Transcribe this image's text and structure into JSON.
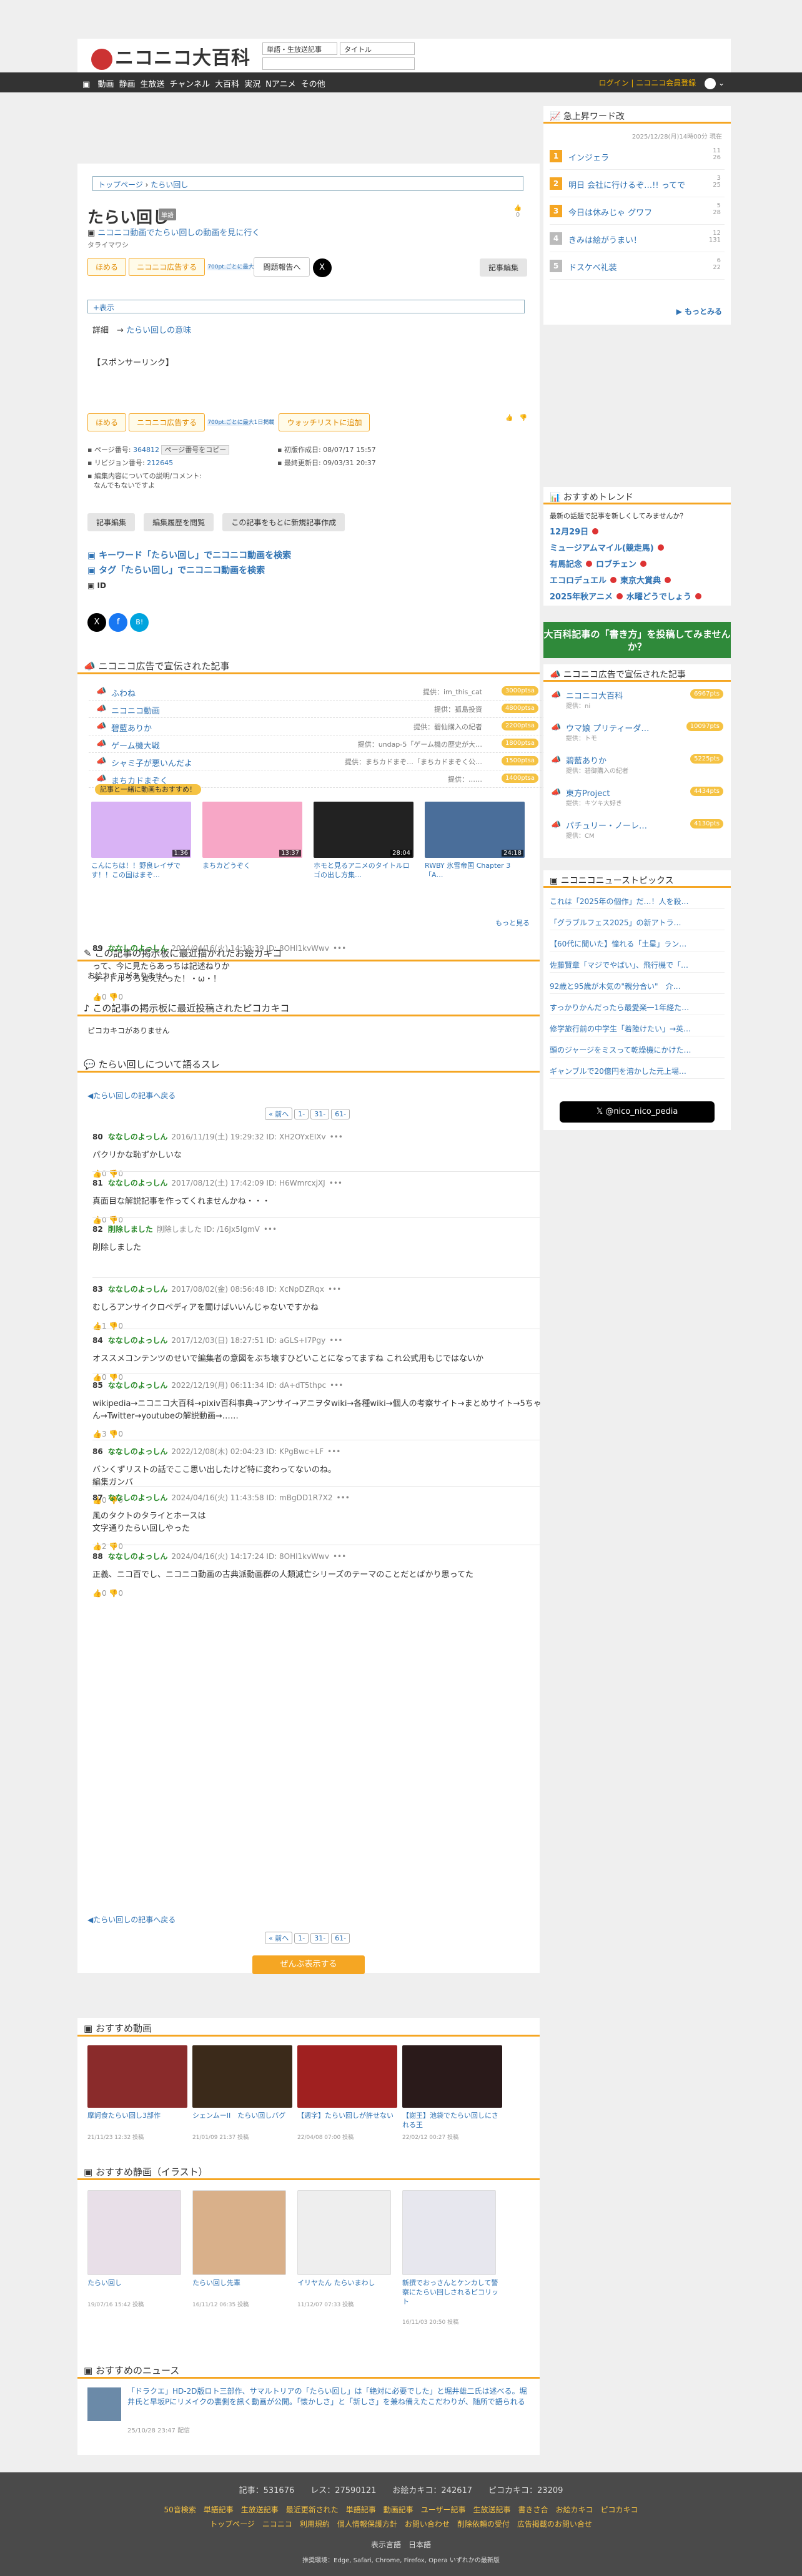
{
  "header": {
    "logo": "ニコニコ大百科",
    "select_scope": "単語・生放送記事",
    "select_field": "タイトル",
    "nav": [
      "動画",
      "静画",
      "生放送",
      "チャンネル",
      "大百科",
      "実況",
      "Nアニメ",
      "その他"
    ],
    "login": "ログイン",
    "premium": "ニコニコ会員登録"
  },
  "article": {
    "breadcrumb_top": "トップページ",
    "breadcrumb_current": "たらい回し",
    "title": "たらい回し",
    "title_tag": "単語",
    "reading": "タライマワシ",
    "video_link": "ニコニコ動画でたらい回しの動画を見に行く",
    "btn_like": "ほめる",
    "btn_ad": "ニコニコ広告する",
    "btn_ad_note": "700pt.ごとに最大1日掲載",
    "btn_report": "問題報告へ",
    "btn_edit": "記事編集",
    "likes": "0",
    "show_link": "+表示",
    "detail_label": "詳細",
    "detail_arrow": "→",
    "detail_link": "たらい回しの意味",
    "sponsor": "【スポンサーリンク】",
    "watch": "ウォッチリストに追加",
    "page_no_label": "ページ番号:",
    "page_no": "364812",
    "copy_btn": "ページ番号をコピー",
    "created_label": "初版作成日:",
    "created": "08/07/17 15:57",
    "rev_label": "リビジョン番号:",
    "rev": "212645",
    "updated_label": "最終更新日:",
    "updated": "09/03/31 20:37",
    "comment_label": "編集内容についての説明/コメント:",
    "comment": "なんでもないですよ",
    "btn_edit2": "記事編集",
    "btn_history": "編集履歴を閲覧",
    "btn_new": "この記事をもとに新規記事作成",
    "search_kw": "キーワード「たらい回し」でニコニコ動画を検索",
    "search_tag": "タグ「たらい回し」でニコニコ動画を検索",
    "id_label": "ID"
  },
  "ads_section": {
    "title": "ニコニコ広告で宣伝された記事",
    "items": [
      {
        "name": "ふわね",
        "by": "提供：im_this_cat",
        "pts": "3000ptsa"
      },
      {
        "name": "ニコニコ動画",
        "by": "提供：孤島投資",
        "pts": "4800ptsa"
      },
      {
        "name": "碧藍ありか",
        "by": "提供：碧仙購入の紀者",
        "pts": "2200ptsa"
      },
      {
        "name": "ゲーム機大戦",
        "by": "提供：undap-5「ゲーム機の歴史が大…",
        "pts": "1800ptsa"
      },
      {
        "name": "シャミ子が悪いんだよ",
        "by": "提供：まちカドまぞ…「まちカドまぞく公…",
        "pts": "1500ptsa"
      },
      {
        "name": "まちカドまぞく",
        "by": "提供：……",
        "pts": "1400ptsa"
      }
    ],
    "badge": "記事と一緒に動画もおすすめ！",
    "videos": [
      {
        "title": "こんにちは！！野良レイザです！！この国はまぞ…",
        "dur": "1:36"
      },
      {
        "title": "まちカどうぞく",
        "dur": "13:37"
      },
      {
        "title": "ホモと見るアニメのタイトルロゴの出し方集…",
        "dur": "28:04"
      },
      {
        "title": "RWBY 氷雪帝国 Chapter 3「A…",
        "dur": "24:18"
      }
    ],
    "more": "もっと見る"
  },
  "bbs": {
    "pic_title": "この記事の掲示板に最近描かれたお絵カキコ",
    "pic_empty": "お絵カキコがありません",
    "pico_title": "この記事の掲示板に最近投稿されたピコカキコ",
    "pico_empty": "ピコカキコがありません",
    "thread_title": "たらい回しについて語るスレ",
    "back": "◀たらい回しの記事へ戻る",
    "pager": [
      "« 前へ",
      "1-",
      "31-",
      "61-"
    ],
    "posts": [
      {
        "no": "80",
        "name": "ななしのよっしん",
        "date": "2016/11/19(土) 19:29:32 ID: XH2OYxEIXv",
        "body": "パクリかな恥ずかしいな",
        "ft": "👍0 👎0"
      },
      {
        "no": "81",
        "name": "ななしのよっしん",
        "date": "2017/08/12(土) 17:42:09 ID: H6WmrcxjXJ",
        "body": "真面目な解説記事を作ってくれませんかね・・・",
        "ft": "👍0 👎0"
      },
      {
        "no": "82",
        "name": "削除しました",
        "date": "削除しました ID: /16Jx5IgmV",
        "body": "削除しました",
        "ft": ""
      },
      {
        "no": "83",
        "name": "ななしのよっしん",
        "date": "2017/08/02(金) 08:56:48 ID: XcNpDZRqx",
        "body": "むしろアンサイクロペディアを聞けばいいんじゃないですかね",
        "ft": "👍1 👎0"
      },
      {
        "no": "84",
        "name": "ななしのよっしん",
        "date": "2017/12/03(日) 18:27:51 ID: aGLS+I7Pgy",
        "body": "オススメコンテンツのせいで編集者の意図をぶち壊すひどいことになってますね これ公式用もじではないか",
        "ft": "👍0 👎0"
      },
      {
        "no": "85",
        "name": "ななしのよっしん",
        "date": "2022/12/19(月) 06:11:34 ID: dA+dT5thpc",
        "body": "wikipedia→ニコニコ大百科→pixiv百科事典→アンサイ→アニヲタwiki→各種wiki→個人の考察サイト→まとめサイト→5ちゃん→Twitter→youtubeの解説動画→……",
        "ft": "👍3 👎0"
      },
      {
        "no": "86",
        "name": "ななしのよっしん",
        "date": "2022/12/08(木) 02:04:23 ID: KPgBwc+LF",
        "body": "バンくずリストの話でここ思い出したけど特に変わってないのね。\n編集ガンバ",
        "ft": "👍0 👎0"
      },
      {
        "no": "87",
        "name": "ななしのよっしん",
        "date": "2024/04/16(火) 11:43:58 ID: mBgDD1R7X2",
        "body": "風のタクトのタライとホースは\n文字通りたらい回しやった",
        "ft": "👍2 👎0"
      },
      {
        "no": "88",
        "name": "ななしのよっしん",
        "date": "2024/04/16(火) 14:17:24 ID: 8OHl1kvWwv",
        "body": "正義、ニコ百でし、ニコニコ動画の古典派動画群の人類滅亡シリーズのテーマのことだとばかり思ってた",
        "ft": "👍0 👎0"
      },
      {
        "no": "89",
        "name": "ななしのよっしん",
        "date": "2024/04/16(火) 14:18:39 ID: 8OHl1kvWwv",
        "body": "って、今に見たらあっちは記述ねりか\nタイトルうろ覚えだった！・ω・！",
        "ft": "👍0 👎0"
      }
    ],
    "show_all": "ぜんぶ表示する"
  },
  "recommend": {
    "video_title": "おすすめ動画",
    "videos": [
      {
        "title": "摩訶食たらい回し3部作",
        "date": "21/11/23 12:32 投稿"
      },
      {
        "title": "シェンムーII　たらい回しバグ",
        "date": "21/01/09 21:37 投稿"
      },
      {
        "title": "【週字】たらい回しが許せない",
        "date": "22/04/08 07:00 投稿"
      },
      {
        "title": "【謝王】池袋でたらい回しにされる王",
        "date": "22/02/12 00:27 投稿"
      }
    ],
    "seiga_title": "おすすめ静画（イラスト）",
    "seiga": [
      {
        "title": "たらい回し",
        "date": "19/07/16 15:42 投稿"
      },
      {
        "title": "たらい回し先輩",
        "date": "16/11/12 06:35 投稿"
      },
      {
        "title": "イリヤたん たらいまわし",
        "date": "11/12/07 07:33 投稿"
      },
      {
        "title": "新撰でおっさんとケンカして警察にたらい回しされるピコリット",
        "date": "16/11/03 20:50 投稿"
      }
    ],
    "news_title": "おすすめのニュース",
    "news": {
      "title": "「ドラクエ」HD-2D版ロト三部作、サマルトリアの「たらい回し」は「絶対に必要でした」と堀井雄二氏は述べる。堀井氏と早坂Pにリメイクの裏側を訊く動画が公開。「懐かしさ」と「新しさ」を兼ね備えたこだわりが、随所で語られる",
      "date": "25/10/28 23:47 配信"
    }
  },
  "side": {
    "kw_title": "急上昇ワード改",
    "kw_date": "2025/12/28(月)14時00分 現在",
    "keywords": [
      {
        "t": "インジェラ",
        "c": "11\n26"
      },
      {
        "t": "明日 会社に行けるぞ…!! ってで",
        "c": "3\n25"
      },
      {
        "t": "今日は休みじゃ グワフ",
        "c": "5\n28"
      },
      {
        "t": "きみは絵がうまい！",
        "c": "12\n131"
      },
      {
        "t": "ドスケベ礼装",
        "c": "6\n22"
      }
    ],
    "kw_more": "▶ もっとみる",
    "trend_title": "おすすめトレンド",
    "trend_note": "最新の話題で記事を新しくしてみませんか？",
    "trends": [
      "12月29日",
      "ミュージアムマイル(競走馬)",
      "有馬記念",
      "ロブチェン",
      "エコロデュエル",
      "東京大賞典",
      "2025年秋アニメ",
      "水曜どうでしょう"
    ],
    "banner": "大百科記事の「書き方」を投稿してみませんか？",
    "ads_title": "ニコニコ広告で宣伝された記事",
    "ads": [
      {
        "t": "ニコニコ大百科",
        "by": "提供：ni",
        "p": "6967pts"
      },
      {
        "t": "ウマ娘 プリティーダ…",
        "by": "提供：トモ",
        "p": "10097pts"
      },
      {
        "t": "碧藍ありか",
        "by": "提供：碧御購入の紀者",
        "p": "5225pts"
      },
      {
        "t": "東方Project",
        "by": "提供：キツキ大好き",
        "p": "4434pts"
      },
      {
        "t": "パチュリー・ノーレ…",
        "by": "提供：CM",
        "p": "4130pts"
      }
    ],
    "news_title": "ニコニコニューストピックス",
    "news": [
      "これは「2025年の個作」だ…！人を殺…",
      "「グラブルフェス2025」の新アトラ…",
      "【60代に聞いた】憧れる「土星」ラン…",
      "佐藤賢章「マジでやばい」、飛行機で「…",
      "92歳と95歳が木気の\"親分合い\"　介…",
      "すっかりかんだったら最愛楽一1年経た…",
      "修学旅行前の中学生「着陸けたい」→英…",
      "頭のジャージをミスって乾燥機にかけた…",
      "ギャンブルで20億円を溶かした元上場…"
    ],
    "x_btn": "@nico_nico_pedia"
  },
  "footer": {
    "stats": "記事：531676　　レス：27590121　　お絵カキコ：242617　　ピコカキコ：23209",
    "links1": "50音検索　単語記事　生放送記事　最近更新された　単語記事　動画記事　ユーザー記事　生放送記事　書きさ合　お絵カキコ　ピコカキコ",
    "links2": "トップページ　ニコニコ　利用規約　個人情報保護方針　お問い合わせ　削除依頼の受付　広告掲載のお問い合せ",
    "lang": "表示言語　日本語",
    "env": "推奨環境：Edge, Safari, Chrome, Firefox, Opera いずれかの最新版"
  }
}
